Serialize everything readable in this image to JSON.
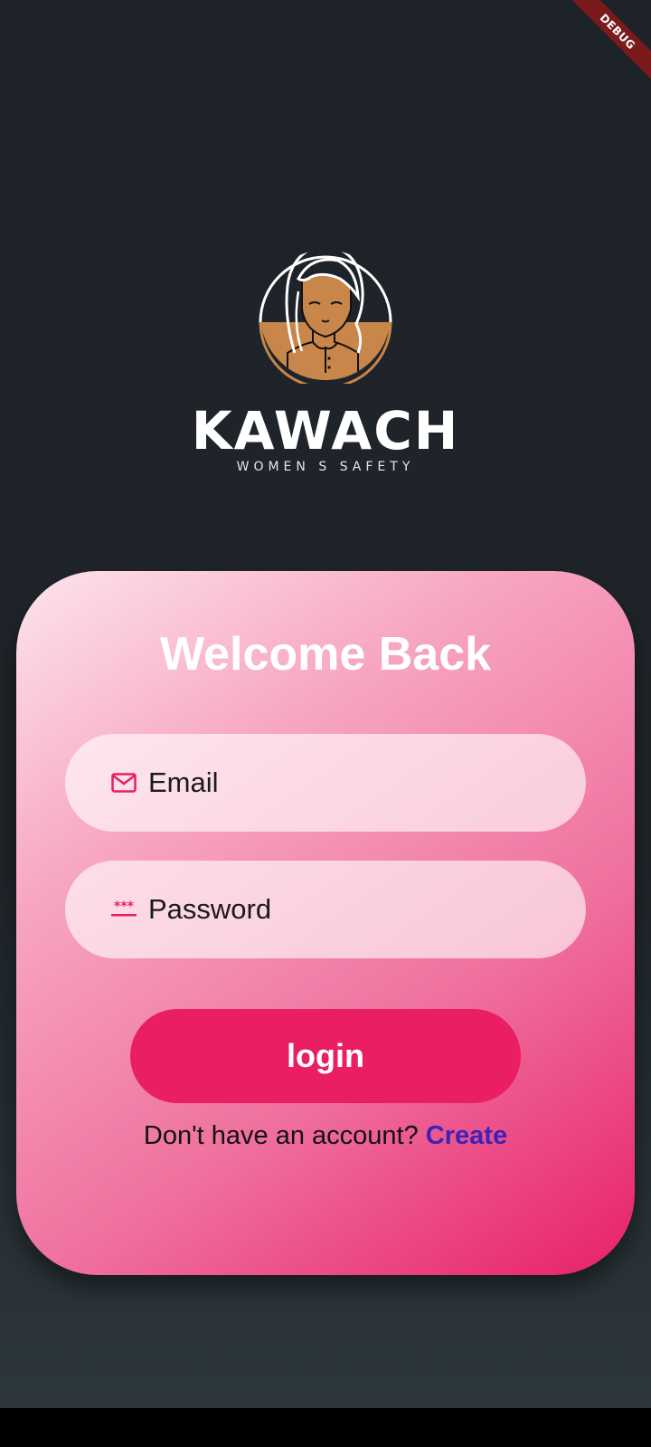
{
  "debug_banner": "DEBUG",
  "brand": {
    "name": "KAWACH",
    "tagline": "WOMEN S SAFETY",
    "logo_icon": "woman-avatar-icon",
    "colors": {
      "skin": "#c8864a",
      "outline": "#ffffff"
    }
  },
  "login_card": {
    "title": "Welcome Back",
    "email": {
      "placeholder": "Email",
      "value": "",
      "icon": "mail-icon"
    },
    "password": {
      "placeholder": "Password",
      "value": "",
      "icon": "password-icon"
    },
    "login_button": "login",
    "signup_prompt": "Don't have an account?",
    "signup_link": "Create"
  },
  "colors": {
    "accent": "#e91e63",
    "link": "#3c22b8",
    "background": "#1e2329"
  }
}
